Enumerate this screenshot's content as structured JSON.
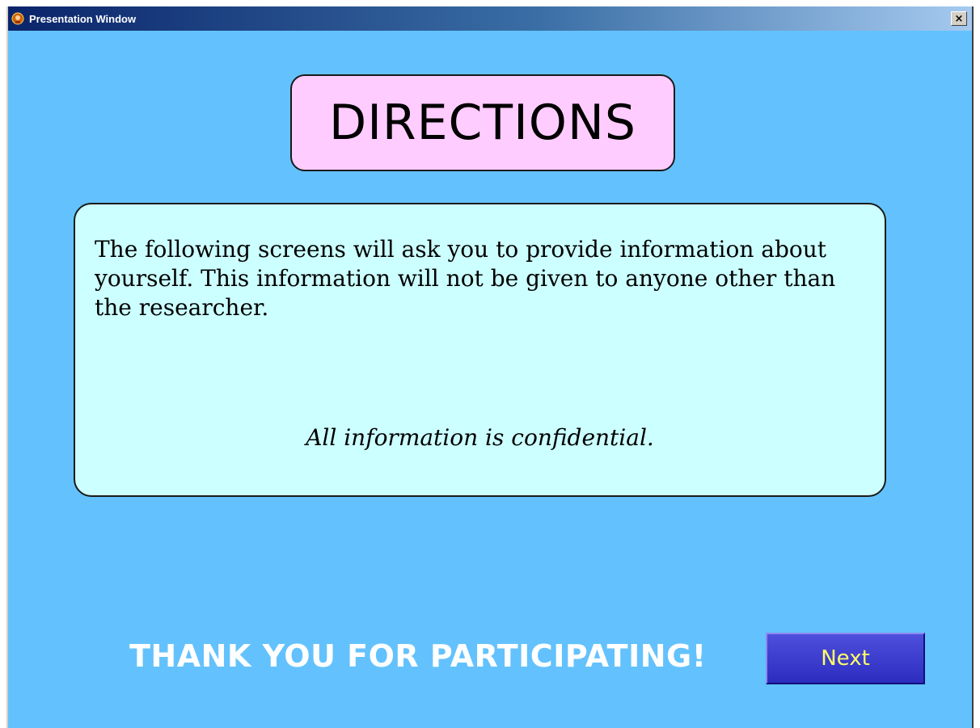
{
  "window": {
    "title": "Presentation Window",
    "icon": "app-icon",
    "close_label": "×",
    "close_icon": "close-icon"
  },
  "heading": {
    "text": "DIRECTIONS"
  },
  "info": {
    "body": "The following screens will ask you to provide information about yourself. This information will not be given to anyone other than the researcher.",
    "note": "All information is confidential."
  },
  "footer": {
    "thanks": "THANK YOU FOR PARTICIPATING!",
    "next_label": "Next"
  },
  "colors": {
    "background": "#63c2fd",
    "heading_box": "#ffccff",
    "info_box": "#ccffff",
    "next_button": "#3333cc",
    "next_text": "#ffff66",
    "thanks_text": "#ffffff"
  }
}
